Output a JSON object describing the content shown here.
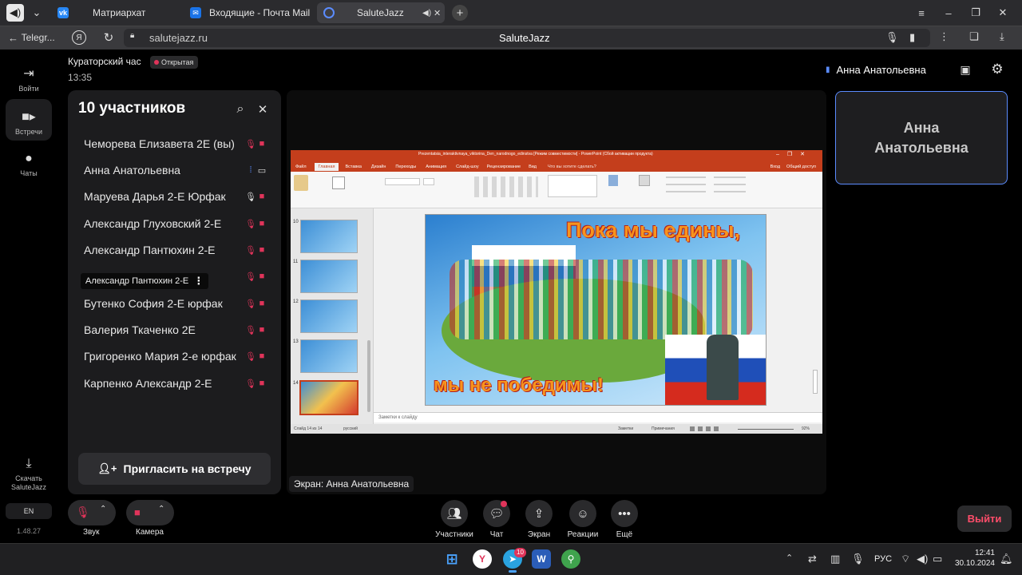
{
  "browser": {
    "tabs": [
      {
        "label": "Матриархат"
      },
      {
        "label": "Входящие - Почта Mail"
      },
      {
        "label": "SaluteJazz"
      }
    ],
    "back_label": "Telegr...",
    "url": "salutejazz.ru",
    "page_title": "SaluteJazz"
  },
  "nav": {
    "login": "Войти",
    "meetings": "Встречи",
    "chats": "Чаты",
    "download": "Скачать SaluteJazz",
    "lang": "EN",
    "version": "1.48.27"
  },
  "meeting": {
    "title": "Кураторский час",
    "badge": "Открытая",
    "time": "13:35",
    "speaker": "Анна Анатольевна",
    "tile_name": "Анна Анатольевна"
  },
  "participants": {
    "heading": "10 участников",
    "tooltip": "Александр Пантюхин 2-Е",
    "list": [
      {
        "name": "Чеморева Елизавета 2Е (вы)"
      },
      {
        "name": "Анна Анатольевна"
      },
      {
        "name": "Маруева Дарья 2-Е Юрфак"
      },
      {
        "name": "Александр Глуховский 2-Е"
      },
      {
        "name": "Александр Пантюхин 2-Е"
      },
      {
        "name": ""
      },
      {
        "name": "Бутенко София 2-Е юрфак"
      },
      {
        "name": "Валерия Ткаченко 2Е"
      },
      {
        "name": "Григоренко Мария 2-е юрфак"
      },
      {
        "name": "Карпенко Александр 2-Е"
      }
    ],
    "invite": "Пригласить на встречу"
  },
  "screen": {
    "caption": "Экран: Анна Анатольевна",
    "ppt_title": "Prezentatsia_interaktivnaya_viktorina_Den_narodnogo_edinstva [Режим совместимости] - PowerPoint (Сбой активации продукта)",
    "ribbon_tabs": [
      "Файл",
      "Главная",
      "Вставка",
      "Дизайн",
      "Переходы",
      "Анимация",
      "Слайд-шоу",
      "Рецензирование",
      "Вид"
    ],
    "ribbon_search": "Что вы хотите сделать?",
    "ribbon_right": [
      "Вход",
      "Общий доступ"
    ],
    "slide_nums": [
      "10",
      "11",
      "12",
      "13",
      "14"
    ],
    "slide_top": "Пока мы едины,",
    "slide_bottom": "мы не победимы!",
    "notes": "Заметки к слайду",
    "status_left": "Слайд 14 из 14",
    "status_lang": "русский",
    "status_notes": "Заметки",
    "status_comments": "Примечания",
    "zoom": "92%"
  },
  "controls": {
    "sound": "Звук",
    "camera": "Камера",
    "participants": "Участники",
    "chat": "Чат",
    "screen": "Экран",
    "reactions": "Реакции",
    "more": "Ещё",
    "leave": "Выйти"
  },
  "taskbar": {
    "lang": "РУС",
    "time": "12:41",
    "date": "30.10.2024",
    "telegram_badge": "10"
  },
  "colors": {
    "accent": "#5b8cff",
    "danger": "#e0345a",
    "ppt_red": "#c43e1c"
  }
}
